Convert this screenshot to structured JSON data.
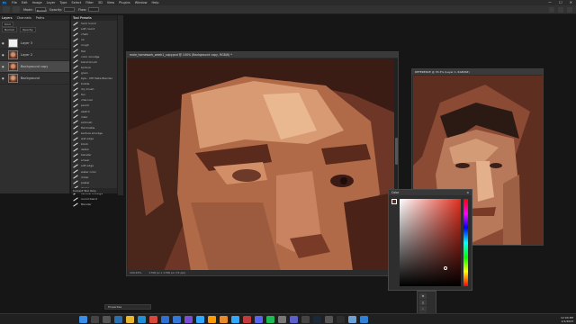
{
  "menubar": {
    "logo": "Ps",
    "items": [
      "File",
      "Edit",
      "Image",
      "Layer",
      "Type",
      "Select",
      "Filter",
      "3D",
      "View",
      "Plugins",
      "Window",
      "Help"
    ],
    "window_controls": [
      "—",
      "☐",
      "✕"
    ]
  },
  "optionsbar": {
    "mode_label": "Mode:",
    "mode_value": "Normal",
    "opacity_label": "Opacity:",
    "flow_label": "Flow:"
  },
  "layers_panel": {
    "tabs": [
      "Layers",
      "Channels",
      "Paths"
    ],
    "kind_label": "Kind",
    "blend_mode": "Normal",
    "opacity_label": "Opacity:",
    "layers": [
      {
        "name": "Layer 3",
        "thumb": "white"
      },
      {
        "name": "Layer 2",
        "thumb": "face"
      },
      {
        "name": "Background copy",
        "thumb": "face"
      },
      {
        "name": "Background",
        "thumb": "face2"
      }
    ]
  },
  "brush_panel": {
    "title": "Tool Presets",
    "items": [
      "hard round",
      "soft round",
      "chalk",
      "oil",
      "rough",
      "flat",
      "color smudge",
      "blend brush",
      "texture",
      "grain",
      "Kyle - MH Meta Blender",
      "bristle",
      "dry brush",
      "fan",
      "charcoal",
      "pencil",
      "sketch",
      "inker",
      "airbrush",
      "flat bristle",
      "texture smudge",
      "wet edge",
      "block",
      "detail",
      "blender",
      "smear",
      "soft edge",
      "water color",
      "mixer",
      "pastel",
      "dense",
      "vertical smudge",
      "round blend",
      "Blender"
    ],
    "footer": "Current Tool Only"
  },
  "document": {
    "title": "male_homework_week1_copy.psd @ 100% (Background copy, RGB/8) *",
    "zoom": "100.45%",
    "doc_info": "1798 px x 1798 px (72 ppi)"
  },
  "reference": {
    "title": "REFERENCE @ 33.3% (Layer 1, RGB/8#)"
  },
  "color_panel": {
    "title": "Color",
    "colors": {
      "foreground": "#5a2e22",
      "hue": "#e0301e"
    }
  },
  "mini_tools": [
    "✥",
    "◻",
    "⌕",
    "⤢"
  ],
  "properties": {
    "label": "Properties"
  },
  "taskbar": {
    "apps": [
      "windows-start",
      "search",
      "task-view",
      "widgets",
      "explorer",
      "edge",
      "chrome",
      "store",
      "mail",
      "photos",
      "photoshop",
      "illustrator",
      "bridge",
      "lightroom",
      "media",
      "discord",
      "spotify",
      "settings",
      "teams",
      "obs",
      "steam",
      "calculator",
      "terminal",
      "notepad",
      "vscode"
    ],
    "time": "12:00 PM",
    "date": "1/1/2023"
  }
}
